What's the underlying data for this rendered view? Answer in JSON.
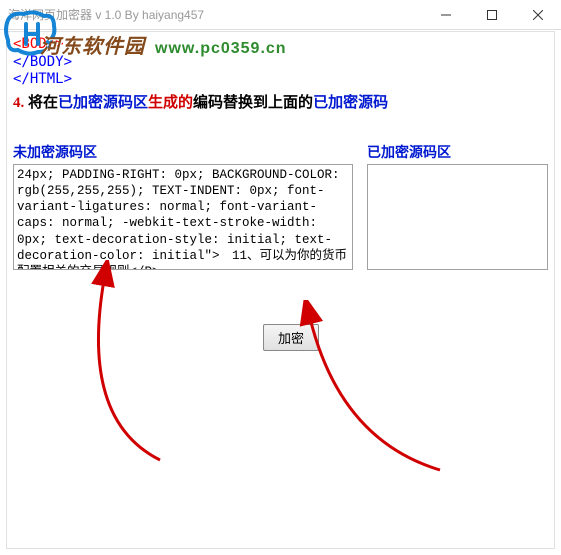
{
  "window": {
    "title": "海洋网页加密器 v 1.0  By haiyang457"
  },
  "watermark": {
    "site_name": "河东软件园",
    "site_url": "www.pc0359.cn"
  },
  "code_tags": {
    "body_open": "<BODY>",
    "body_close": "</BODY>",
    "html_close": "</HTML>"
  },
  "instruction": {
    "num": "4.",
    "t1": " 将在",
    "t2": "已加密源码区",
    "t3": "生成的",
    "t4": "编码替换到上面的",
    "t5": "已加密源码"
  },
  "panels": {
    "left_label": "未加密源码区",
    "right_label": "已加密源码区",
    "left_value": "24px; PADDING-RIGHT: 0px; BACKGROUND-COLOR: rgb(255,255,255); TEXT-INDENT: 0px; font-variant-ligatures: normal; font-variant-caps: normal; -webkit-text-stroke-width: 0px; text-decoration-style: initial; text-decoration-color: initial\">　11、可以为你的货币配置相关的交易规则</P>",
    "right_value": ""
  },
  "buttons": {
    "encrypt": "加密"
  }
}
